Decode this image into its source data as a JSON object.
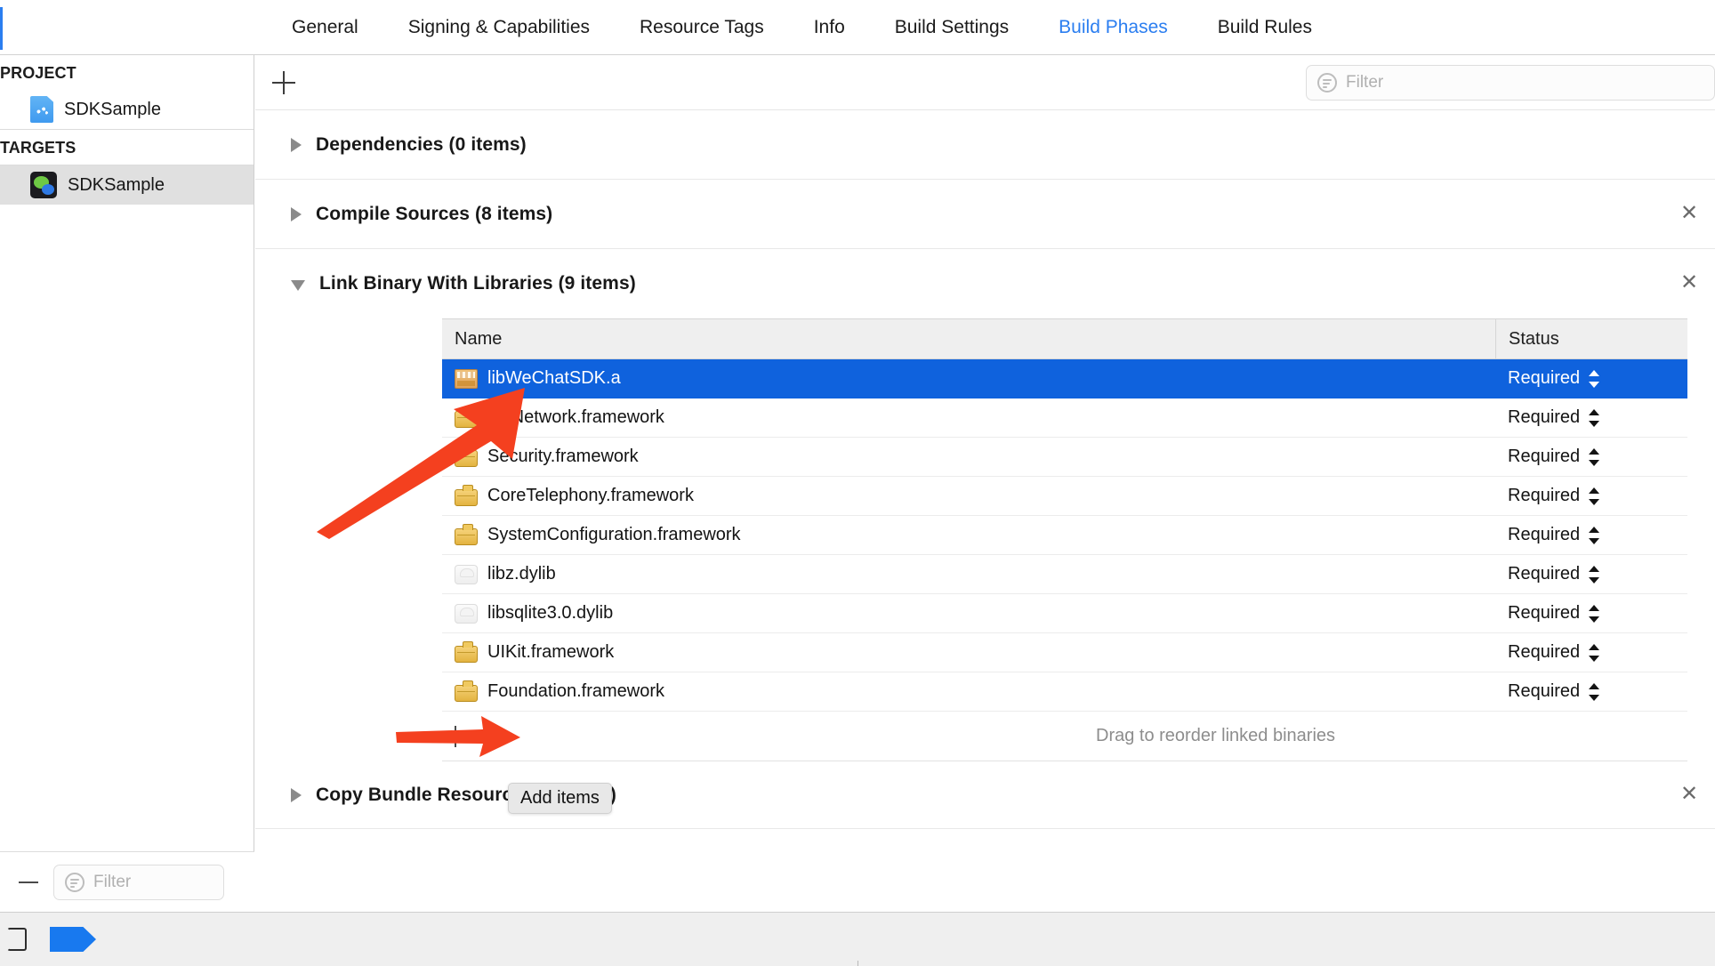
{
  "tabs": [
    {
      "label": "General",
      "active": false
    },
    {
      "label": "Signing & Capabilities",
      "active": false
    },
    {
      "label": "Resource Tags",
      "active": false
    },
    {
      "label": "Info",
      "active": false
    },
    {
      "label": "Build Settings",
      "active": false
    },
    {
      "label": "Build Phases",
      "active": true
    },
    {
      "label": "Build Rules",
      "active": false
    }
  ],
  "sidebar": {
    "project_header": "PROJECT",
    "project_item": "SDKSample",
    "targets_header": "TARGETS",
    "target_item": "SDKSample",
    "filter_placeholder": "Filter"
  },
  "toolbar": {
    "add_phase_label": "+",
    "filter_placeholder": "Filter"
  },
  "phases": [
    {
      "title": "Dependencies (0 items)",
      "expanded": false,
      "removable": false
    },
    {
      "title": "Compile Sources (8 items)",
      "expanded": false,
      "removable": true
    },
    {
      "title": "Link Binary With Libraries (9 items)",
      "expanded": true,
      "removable": true
    },
    {
      "title": "Copy Bundle Resources (1 items)",
      "expanded": false,
      "removable": true
    }
  ],
  "link_table": {
    "columns": {
      "name": "Name",
      "status": "Status"
    },
    "rows": [
      {
        "name": "libWeChatSDK.a",
        "icon": "archive-icon",
        "status": "Required",
        "selected": true
      },
      {
        "name": "CFNetwork.framework",
        "icon": "briefcase-icon",
        "status": "Required",
        "selected": false
      },
      {
        "name": "Security.framework",
        "icon": "briefcase-icon",
        "status": "Required",
        "selected": false
      },
      {
        "name": "CoreTelephony.framework",
        "icon": "briefcase-icon",
        "status": "Required",
        "selected": false
      },
      {
        "name": "SystemConfiguration.framework",
        "icon": "briefcase-icon",
        "status": "Required",
        "selected": false
      },
      {
        "name": "libz.dylib",
        "icon": "dylib-icon",
        "status": "Required",
        "selected": false
      },
      {
        "name": "libsqlite3.0.dylib",
        "icon": "dylib-icon",
        "status": "Required",
        "selected": false
      },
      {
        "name": "UIKit.framework",
        "icon": "briefcase-icon",
        "status": "Required",
        "selected": false
      },
      {
        "name": "Foundation.framework",
        "icon": "briefcase-icon",
        "status": "Required",
        "selected": false
      }
    ],
    "footer_hint": "Drag to reorder linked binaries"
  },
  "tooltip": {
    "text": "Add items"
  },
  "colors": {
    "accent_blue": "#2b7ef0",
    "selection_blue": "#0f62dd",
    "annotation_red": "#f4401f",
    "framework_gold": "#e3b340"
  }
}
